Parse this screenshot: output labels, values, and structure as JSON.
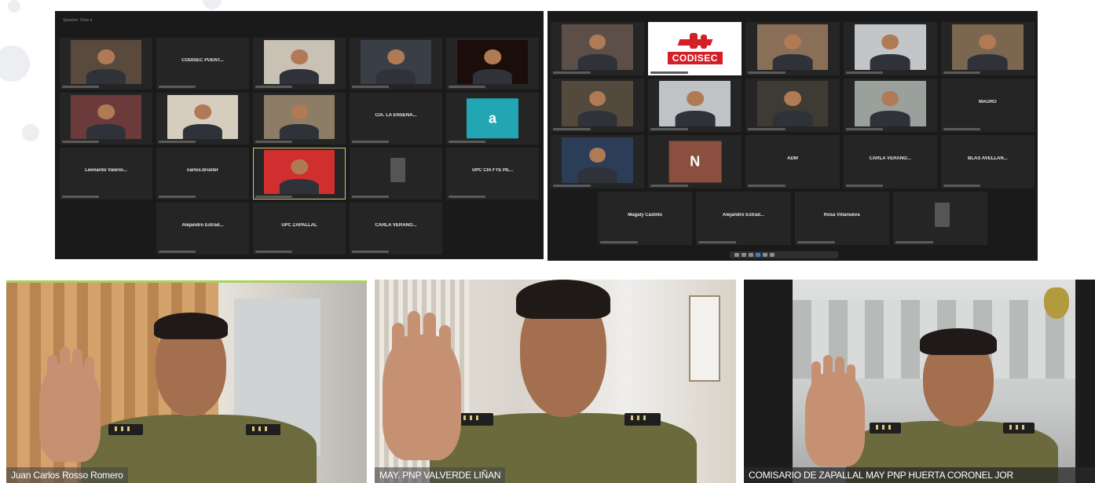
{
  "left_meeting": {
    "header_label": "Speaker View ▾",
    "tiles": [
      {
        "name": "",
        "kind": "photo",
        "bg": "#5a4a3e"
      },
      {
        "name": "CODISEC PUENT...",
        "kind": "name"
      },
      {
        "name": "",
        "kind": "photo",
        "bg": "#c8c1b4"
      },
      {
        "name": "",
        "kind": "photo",
        "bg": "#3a3f47"
      },
      {
        "name": "",
        "kind": "photo",
        "bg": "#1b0d0a"
      },
      {
        "name": "",
        "kind": "photo",
        "bg": "#6b3a3a"
      },
      {
        "name": "",
        "kind": "photo",
        "bg": "#d7cdbe"
      },
      {
        "name": "",
        "kind": "photo",
        "bg": "#8d7c66"
      },
      {
        "name": "CIA. LA ENSENA...",
        "kind": "name"
      },
      {
        "name": "a",
        "kind": "letter",
        "bg": "#23a6b4"
      },
      {
        "name": "Leonardo Valerio...",
        "kind": "name"
      },
      {
        "name": "carlos.bruster",
        "kind": "name"
      },
      {
        "name": "",
        "kind": "photo",
        "bg": "#d12f2f"
      },
      {
        "name": "",
        "kind": "small",
        "bg": "#555555"
      },
      {
        "name": "UPC CIA FTE PE...",
        "kind": "name"
      },
      {
        "name": "",
        "kind": "empty"
      },
      {
        "name": "Alejandro Estrad...",
        "kind": "name"
      },
      {
        "name": "UPC ZAPALLAL",
        "kind": "name"
      },
      {
        "name": "CARLA VERANO...",
        "kind": "name"
      },
      {
        "name": "",
        "kind": "empty"
      }
    ]
  },
  "right_meeting": {
    "row1": [
      {
        "kind": "photo",
        "bg": "#5b4f48"
      },
      {
        "kind": "codisec",
        "text": "CODISEC"
      },
      {
        "kind": "photo",
        "bg": "#8a6f58"
      },
      {
        "kind": "photo",
        "bg": "#c2c6c9"
      },
      {
        "kind": "photo",
        "bg": "#7b6650"
      }
    ],
    "row2": [
      {
        "kind": "photo",
        "bg": "#53493c",
        "name": ""
      },
      {
        "kind": "photo",
        "bg": "#bfc3c6",
        "name": ""
      },
      {
        "kind": "photo",
        "bg": "#3e3a34",
        "name": ""
      },
      {
        "kind": "photo",
        "bg": "#9aa09c",
        "name": ""
      },
      {
        "kind": "name",
        "name": "MAURO"
      }
    ],
    "row3": [
      {
        "kind": "photo",
        "bg": "#2c3d57",
        "name": ""
      },
      {
        "kind": "letter",
        "bg": "#8a4f3e",
        "name": "N"
      },
      {
        "kind": "name",
        "name": "ADM"
      },
      {
        "kind": "name",
        "name": "CARLA VERANO..."
      },
      {
        "kind": "name",
        "name": "BLAS AVELLAN..."
      }
    ],
    "row4": [
      {
        "kind": "name",
        "name": "Magaly Castillo"
      },
      {
        "kind": "name",
        "name": "Alejandro Estrad..."
      },
      {
        "kind": "name",
        "name": "Rosa Villanueva"
      },
      {
        "kind": "small",
        "bg": "#555555",
        "name": ""
      }
    ]
  },
  "videos": {
    "left": {
      "caption": "Juan Carlos Rosso Romero"
    },
    "middle": {
      "caption": "MAY. PNP VALVERDE LIÑAN"
    },
    "right": {
      "caption": "COMISARIO DE ZAPALLAL MAY PNP HUERTA CORONEL JOR"
    }
  },
  "colors": {
    "meeting_bg": "#1a1a1a",
    "tile_bg": "#252525",
    "active_border": "#d6c96a",
    "codisec_red": "#d32027",
    "uniform": "#6d6a3d"
  }
}
